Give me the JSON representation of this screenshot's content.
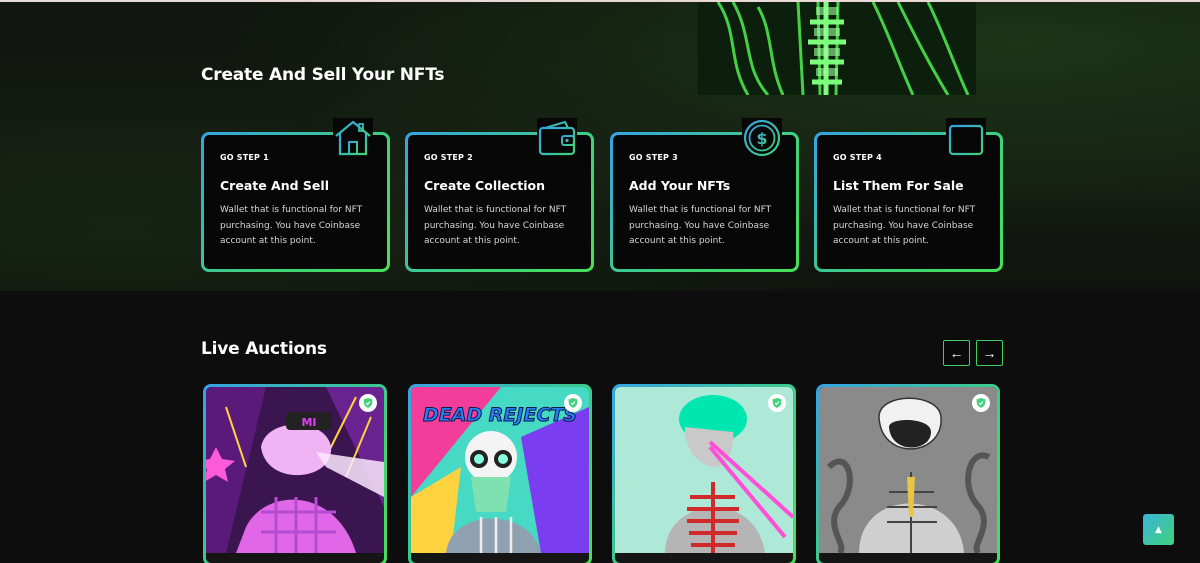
{
  "steps_section": {
    "title": "Create And Sell Your NFTs",
    "steps": [
      {
        "label": "GO STEP 1",
        "title": "Create And Sell",
        "description": "Wallet that is functional for NFT purchasing. You have Coinbase account at this point.",
        "icon": "house-icon"
      },
      {
        "label": "GO STEP 2",
        "title": "Create Collection",
        "description": "Wallet that is functional for NFT purchasing. You have Coinbase account at this point.",
        "icon": "wallet-icon"
      },
      {
        "label": "GO STEP 3",
        "title": "Add Your NFTs",
        "description": "Wallet that is functional for NFT purchasing. You have Coinbase account at this point.",
        "icon": "dollar-coin-icon"
      },
      {
        "label": "GO STEP 4",
        "title": "List Them For Sale",
        "description": "Wallet that is functional for NFT purchasing. You have Coinbase account at this point.",
        "icon": "calendar-icon"
      }
    ]
  },
  "auctions": {
    "title": "Live Auctions",
    "prev_label": "←",
    "next_label": "→",
    "cards": [
      {
        "art_text": "MI"
      },
      {
        "art_text": "DEAD REJECTS"
      },
      {
        "art_text": ""
      },
      {
        "art_text": ""
      }
    ]
  },
  "scroll_top_label": "▲",
  "colors": {
    "accent_green": "#3fd27a",
    "accent_blue": "#35a3e4",
    "background": "#0d0d0d"
  }
}
